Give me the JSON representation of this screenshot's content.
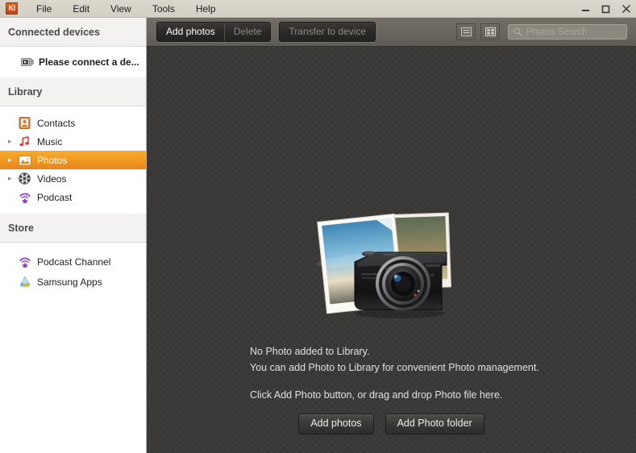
{
  "window": {
    "app_icon_text": "KI",
    "controls": {
      "minimize": "minimize-button",
      "maximize": "maximize-button",
      "close": "close-button"
    }
  },
  "menubar": {
    "items": [
      {
        "label": "File"
      },
      {
        "label": "Edit"
      },
      {
        "label": "View"
      },
      {
        "label": "Tools"
      },
      {
        "label": "Help"
      }
    ]
  },
  "sidebar": {
    "connected_devices": {
      "header": "Connected devices",
      "device_message": "Please connect a de..."
    },
    "library": {
      "header": "Library",
      "items": [
        {
          "label": "Contacts",
          "icon": "contacts-icon",
          "expandable": false,
          "selected": false
        },
        {
          "label": "Music",
          "icon": "music-icon",
          "expandable": true,
          "selected": false
        },
        {
          "label": "Photos",
          "icon": "photos-icon",
          "expandable": true,
          "selected": true
        },
        {
          "label": "Videos",
          "icon": "videos-icon",
          "expandable": true,
          "selected": false
        },
        {
          "label": "Podcast",
          "icon": "podcast-icon",
          "expandable": false,
          "selected": false
        }
      ]
    },
    "store": {
      "header": "Store",
      "items": [
        {
          "label": "Podcast Channel",
          "icon": "podcast-channel-icon"
        },
        {
          "label": "Samsung Apps",
          "icon": "samsung-apps-icon"
        }
      ]
    }
  },
  "toolbar": {
    "add_photos_label": "Add photos",
    "delete_label": "Delete",
    "transfer_label": "Transfer to device",
    "delete_enabled": false,
    "transfer_enabled": false,
    "view_list_icon": "list-view-icon",
    "view_grid_icon": "grid-view-icon",
    "search_placeholder": "Photos Search",
    "search_value": ""
  },
  "main": {
    "empty_state": {
      "line1": "No Photo added to Library.",
      "line2": "You can add Photo to Library for convenient Photo management.",
      "line3": "Click Add Photo button, or drag and drop Photo file here.",
      "add_photos_label": "Add photos",
      "add_photo_folder_label": "Add Photo folder"
    }
  },
  "colors": {
    "accent_orange": "#f09a22",
    "titlebar": "#d5d1c7",
    "toolbar": "#696560",
    "content_bg": "#383735",
    "sidebar_bg": "#ffffff",
    "sidebar_header_bg": "#f3f2f0"
  }
}
